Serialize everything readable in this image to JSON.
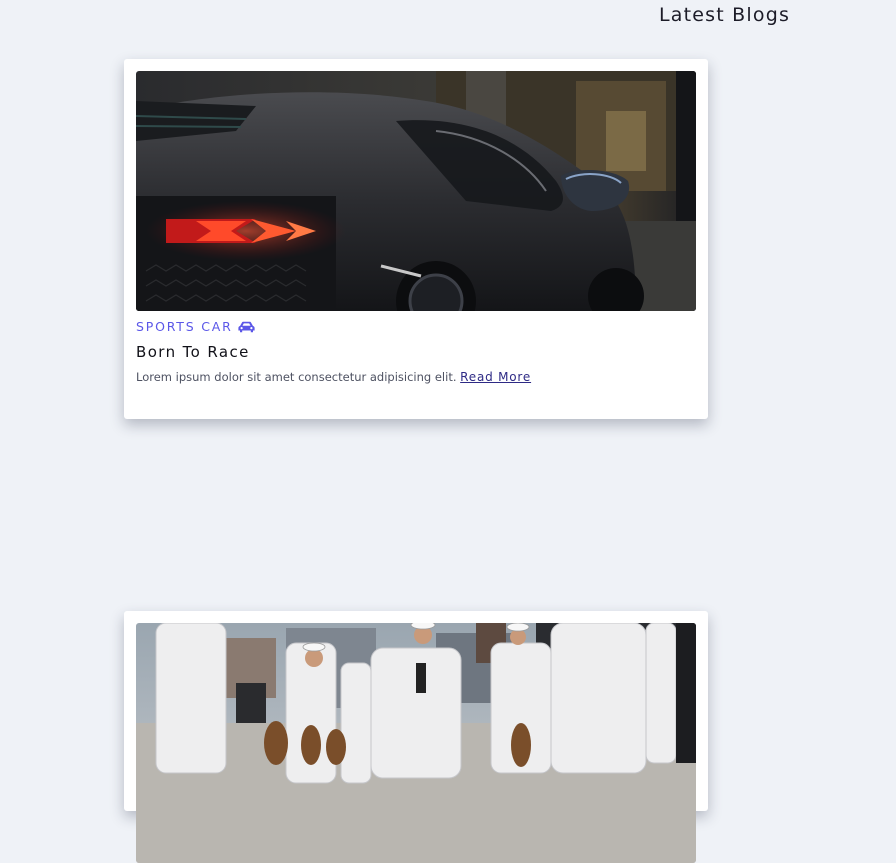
{
  "section": {
    "title": "Latest Blogs"
  },
  "posts": [
    {
      "image_alt": "black sports car tail lights",
      "category": "SPORTS CAR",
      "category_icon": "car-icon",
      "title": "Born To Race",
      "excerpt": "Lorem ipsum dolor sit amet consectetur adipisicing elit.",
      "read_more": "Read More"
    },
    {
      "image_alt": "sailors in white uniforms saluting"
    }
  ],
  "colors": {
    "background": "#eff2f7",
    "accent": "#5b57e8",
    "link": "#2e2a85"
  }
}
